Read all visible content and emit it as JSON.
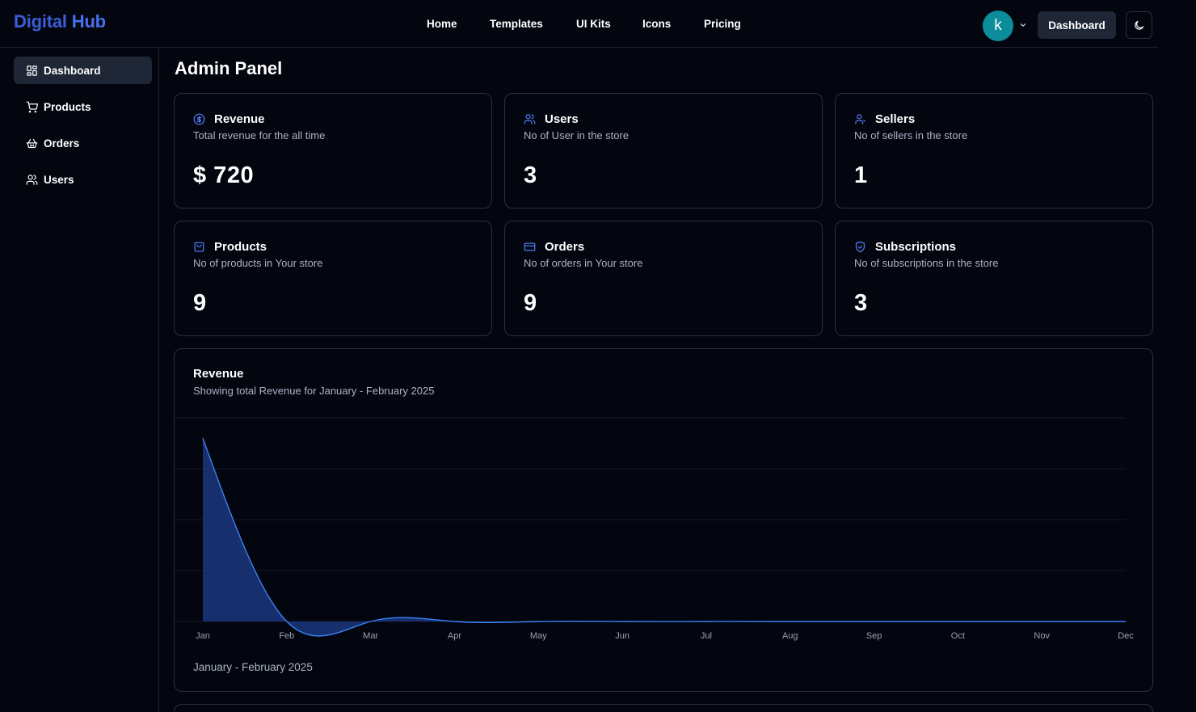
{
  "brand": {
    "part1": "Digital",
    "part2": "Hub"
  },
  "nav": [
    {
      "label": "Home"
    },
    {
      "label": "Templates"
    },
    {
      "label": "UI Kits"
    },
    {
      "label": "Icons"
    },
    {
      "label": "Pricing"
    }
  ],
  "user": {
    "avatar_letter": "k",
    "dashboard_label": "Dashboard",
    "theme_icon": "moon-icon"
  },
  "sidebar": {
    "items": [
      {
        "label": "Dashboard",
        "icon": "layout-grid-icon",
        "active": true
      },
      {
        "label": "Products",
        "icon": "cart-icon",
        "active": false
      },
      {
        "label": "Orders",
        "icon": "basket-icon",
        "active": false
      },
      {
        "label": "Users",
        "icon": "users-icon",
        "active": false
      }
    ]
  },
  "page": {
    "title": "Admin Panel"
  },
  "stats": [
    {
      "title": "Revenue",
      "subtitle": "Total revenue for the all time",
      "value": "$ 720",
      "icon": "dollar-circle-icon"
    },
    {
      "title": "Users",
      "subtitle": "No of User in the store",
      "value": "3",
      "icon": "users-icon"
    },
    {
      "title": "Sellers",
      "subtitle": "No of sellers in the store",
      "value": "1",
      "icon": "user-icon"
    },
    {
      "title": "Products",
      "subtitle": "No of products in Your store",
      "value": "9",
      "icon": "shopping-bag-icon"
    },
    {
      "title": "Orders",
      "subtitle": "No of orders in Your store",
      "value": "9",
      "icon": "credit-card-icon"
    },
    {
      "title": "Subscriptions",
      "subtitle": "No of subscriptions in the store",
      "value": "3",
      "icon": "handshake-icon"
    }
  ],
  "revenue_chart": {
    "title": "Revenue",
    "subtitle": "Showing total Revenue for January - February 2025",
    "footer": "January - February 2025"
  },
  "colors": {
    "accent": "#3b82f6",
    "area_fill": "#1a3478",
    "background": "#03050f",
    "border": "#2a3142"
  },
  "chart_data": {
    "type": "area",
    "x": [
      "Jan",
      "Feb",
      "Mar",
      "Apr",
      "May",
      "Jun",
      "Jul",
      "Aug",
      "Sep",
      "Oct",
      "Nov",
      "Dec"
    ],
    "series": [
      {
        "values": [
          720,
          0,
          0,
          0,
          0,
          0,
          0,
          0,
          0,
          0,
          0,
          0
        ]
      }
    ],
    "ylim": [
      0,
      800
    ],
    "grid": true,
    "curve": "natural"
  }
}
